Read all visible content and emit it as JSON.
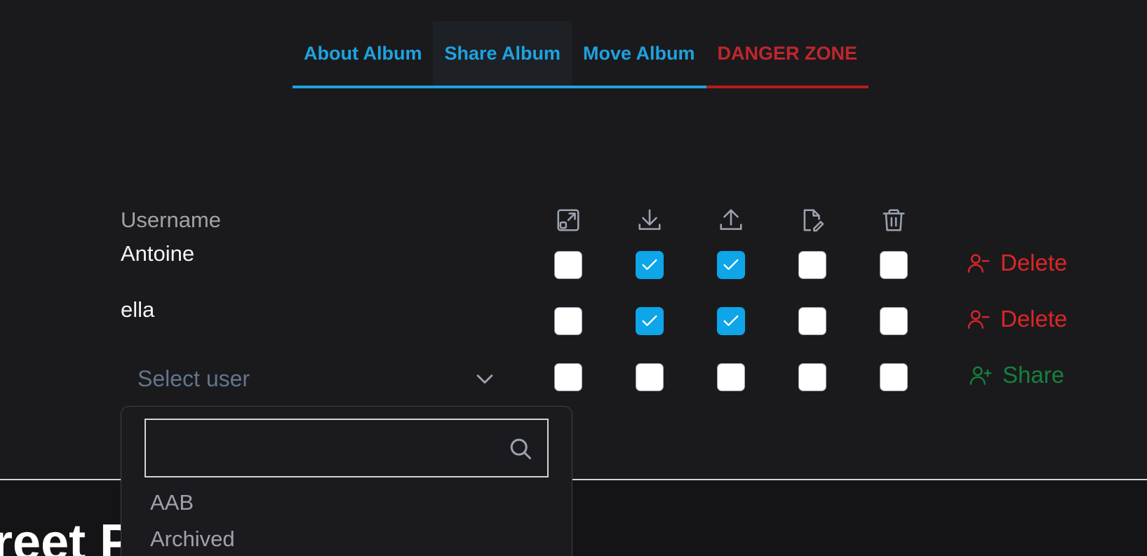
{
  "tabs": [
    {
      "label": "About Album"
    },
    {
      "label": "Share Album"
    },
    {
      "label": "Move Album"
    },
    {
      "label": "DANGER ZONE"
    }
  ],
  "share": {
    "username_header": "Username",
    "permission_icons": [
      "open-external-icon",
      "download-icon",
      "upload-icon",
      "file-edit-icon",
      "trash-icon"
    ],
    "rows": [
      {
        "username": "Antoine",
        "permissions": [
          false,
          true,
          true,
          false,
          false
        ],
        "action": "Delete"
      },
      {
        "username": "ella",
        "permissions": [
          false,
          true,
          true,
          false,
          false
        ],
        "action": "Delete"
      }
    ],
    "new_row": {
      "select_placeholder": "Select user",
      "permissions": [
        false,
        false,
        false,
        false,
        false
      ],
      "action": "Share"
    }
  },
  "dropdown": {
    "search_value": "",
    "options": [
      "AAB",
      "Archived"
    ]
  },
  "footer": {
    "text": "reet P"
  },
  "colors": {
    "accent": "#1ea2e0",
    "danger": "#c0262d",
    "checkbox_checked": "#0ea5e9",
    "delete": "#dc2626",
    "share": "#15803d",
    "background": "#1a1a1d"
  }
}
